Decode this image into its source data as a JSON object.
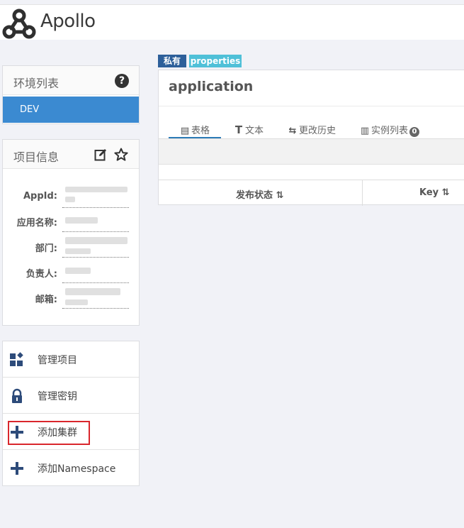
{
  "app": {
    "brand": "Apollo"
  },
  "env_panel": {
    "title": "环境列表",
    "help_icon": "?",
    "items": [
      {
        "label": "DEV",
        "active": true
      }
    ]
  },
  "project_panel": {
    "title": "项目信息",
    "fields": [
      {
        "label": "AppId:"
      },
      {
        "label": "应用名称:"
      },
      {
        "label": "部门:"
      },
      {
        "label": "负责人:"
      },
      {
        "label": "邮箱:"
      }
    ]
  },
  "actions": [
    {
      "label": "管理项目",
      "icon": "grid-icon"
    },
    {
      "label": "管理密钥",
      "icon": "lock-icon"
    },
    {
      "label": "添加集群",
      "icon": "plus-icon",
      "highlighted": true
    },
    {
      "label": "添加Namespace",
      "icon": "plus-icon"
    }
  ],
  "namespace": {
    "tags": {
      "private": "私有",
      "format": "properties"
    },
    "title": "application",
    "tabs": [
      {
        "label": "表格",
        "icon": "table-icon",
        "active": true
      },
      {
        "label": "文本",
        "icon": "text-icon"
      },
      {
        "label": "更改历史",
        "icon": "history-icon"
      },
      {
        "label": "实例列表",
        "icon": "instance-icon",
        "badge": "0"
      }
    ],
    "columns": [
      {
        "label": "发布状态",
        "sort": "sort-icon"
      },
      {
        "label": "Key",
        "sort": "sort-icon"
      }
    ]
  },
  "colors": {
    "accent": "#3b8ad1",
    "tag_private": "#2d5f9a",
    "tag_format": "#4fc0d8",
    "highlight": "#d9262c"
  }
}
